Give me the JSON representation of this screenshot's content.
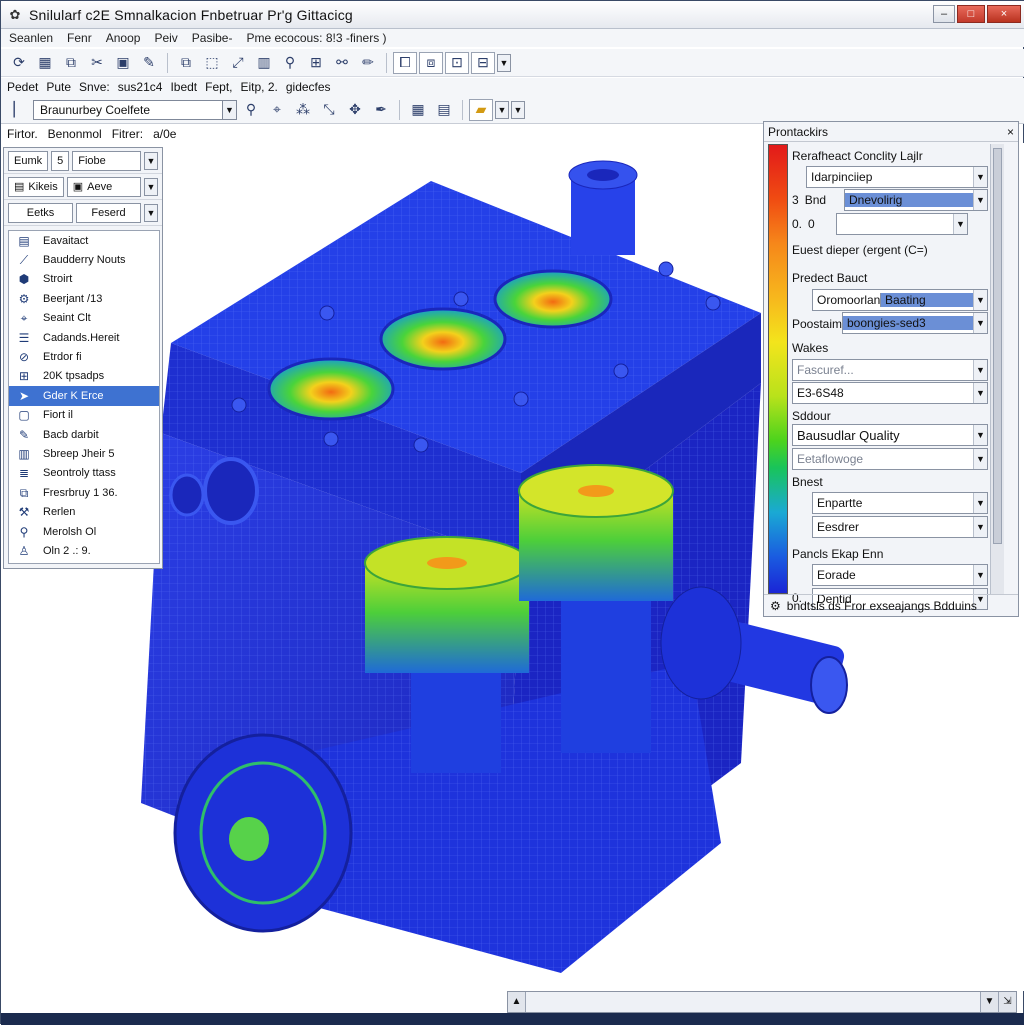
{
  "window": {
    "title": "Snilularf c2E Smnalkacion Fnbetruar Pr'g Gittacicg",
    "controls": {
      "minimize": "–",
      "maximize": "□",
      "close": "×"
    }
  },
  "menu": [
    "Seanlen",
    "Fenr",
    "Anoop",
    "Peiv",
    "Pasibe-",
    "Pme ecocous: 8!3 -finers )"
  ],
  "label_row": [
    "Pedet",
    "Pute",
    "Snve:",
    "sus21c4",
    "Ibedt",
    "Fept,",
    "Eitp, 2.",
    "gidecfes"
  ],
  "combo_main": {
    "value": "Braunurbey Coelfete"
  },
  "path_row": [
    "Firtor.",
    "Benonmol",
    "Fitrer:",
    "a/0e"
  ],
  "left_panel": {
    "row1": {
      "a": "Eumk",
      "b": "5",
      "c": "Fiobe"
    },
    "row2": {
      "a": "Kikeis",
      "b": "Aeve"
    },
    "row3": {
      "a": "Eetks",
      "b": "Feserd"
    },
    "items": [
      {
        "label": "Eavaitact",
        "icon": "document-icon"
      },
      {
        "label": "Baudderry Nouts",
        "icon": "boundary-icon"
      },
      {
        "label": "Stroirt",
        "icon": "structure-icon"
      },
      {
        "label": "Beerjant /13",
        "icon": "gear-icon"
      },
      {
        "label": "Seaint Clt",
        "icon": "select-icon"
      },
      {
        "label": "Cadands.Hereit",
        "icon": "layers-icon"
      },
      {
        "label": "Etrdor fi",
        "icon": "error-icon"
      },
      {
        "label": "20K tpsadps",
        "icon": "mesh-icon"
      },
      {
        "label": "Gder K Erce",
        "icon": "force-icon",
        "selected": true
      },
      {
        "label": "Fiort il",
        "icon": "frame-icon"
      },
      {
        "label": "Bacb darbit",
        "icon": "tool-icon"
      },
      {
        "label": "Sbreep Jheir 5",
        "icon": "chart-icon"
      },
      {
        "label": "Seontroly ttass",
        "icon": "list-icon"
      },
      {
        "label": "Fresrbruy 1 36.",
        "icon": "copy-icon"
      },
      {
        "label": "Rerlen",
        "icon": "hammer-icon"
      },
      {
        "label": "Merolsh Ol",
        "icon": "pin-icon"
      },
      {
        "label": "Oln 2 .: 9.",
        "icon": "person-icon"
      }
    ]
  },
  "right_panel": {
    "title": "Prontackirs",
    "close": "×",
    "rows": {
      "r1": "Rerafheact Conclity Lajlr",
      "f1": "Idarpinciiep",
      "r2_num": "3",
      "r2_label": "Bnd",
      "f2": "Dnevolirig",
      "r3_a": "0.",
      "r3_b": "0",
      "f3": "",
      "r4": "Euest dieper (ergent (C=)",
      "r5": "Predect Bauct",
      "f5a": "Oromoorlant",
      "f5b": "Baating",
      "r6": "Poostaim",
      "f6": "boongies-sed3",
      "r7": "Wakes",
      "f7": "Fascuref...",
      "f8": "E3-6S48",
      "r9": "Sddour",
      "f9": "Bausudlar Quality",
      "f10": "Eetaflowoge",
      "r11": "Bnest",
      "f11": "Enpartte",
      "f12": "Eesdrer",
      "r13": "Pancls Ekap Enn",
      "f13": "Eorade",
      "f14": "Dentid",
      "f14_prefix": "0."
    },
    "status": "bndtsls ds Fror exseajangs Bdduins"
  },
  "legend_colors": [
    "#e21a1a",
    "#f6871a",
    "#f3e41c",
    "#4cd31d",
    "#1aa9d4",
    "#1a25d6"
  ]
}
